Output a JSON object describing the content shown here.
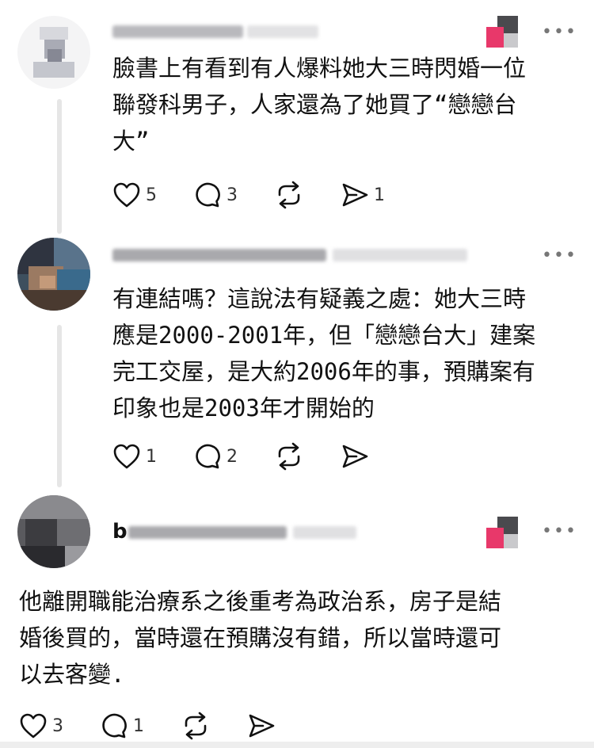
{
  "comments": [
    {
      "name_prefix": "",
      "text": "臉書上有看到有人爆料她大三時閃婚一位\n聯發科男子，人家還為了她買了“戀戀台\n大”",
      "likes": "5",
      "replies": "3",
      "shares": "1",
      "more_label": "•••"
    },
    {
      "name_prefix": "",
      "text": "有連結嗎？這說法有疑義之處：她大三時\n應是2000-2001年，但「戀戀台大」建案\n完工交屋，是大約2006年的事，預購案有\n印象也是2003年才開始的",
      "likes": "1",
      "replies": "2",
      "shares": "",
      "more_label": "•••"
    },
    {
      "name_prefix": "b",
      "text": "他離開職能治療系之後重考為政治系，房子是結\n婚後買的，當時還在預購沒有錯，所以當時還可\n以去客變.",
      "likes": "3",
      "replies": "1",
      "shares": "",
      "more_label": "•••"
    }
  ],
  "icons": {
    "like": "heart-icon",
    "reply": "comment-bubble-icon",
    "repost": "repost-icon",
    "share": "send-icon"
  },
  "colors": {
    "badge_pink": "#e8386a",
    "text": "#111111",
    "muted": "#333333"
  }
}
